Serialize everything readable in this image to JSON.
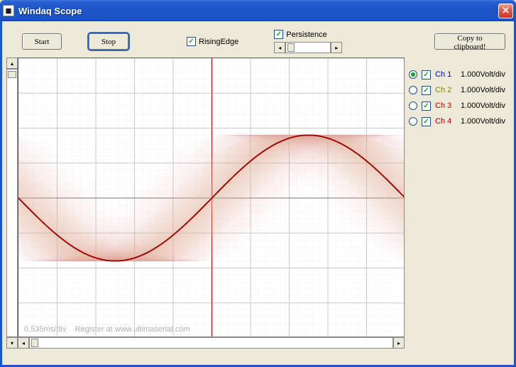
{
  "window": {
    "title": "Windaq Scope",
    "icon_label": "▦"
  },
  "toolbar": {
    "start_label": "Start",
    "stop_label": "Stop",
    "rising_edge_label": "RisingEdge",
    "rising_edge_checked": true,
    "persistence_label": "Persistence",
    "persistence_checked": true,
    "copy_label": "Copy to clipboard!"
  },
  "scope": {
    "timebase_watermark": "0.535ms/div",
    "register_watermark": "Register at www.ultimaserial.com"
  },
  "channels": [
    {
      "selected": true,
      "enabled": true,
      "name": "Ch 1",
      "color_class": "ch-blue",
      "scale": "1.000Volt/div"
    },
    {
      "selected": false,
      "enabled": true,
      "name": "Ch 2",
      "color_class": "ch-olive",
      "scale": "1.000Volt/div"
    },
    {
      "selected": false,
      "enabled": true,
      "name": "Ch 3",
      "color_class": "ch-red",
      "scale": "1.000Volt/div"
    },
    {
      "selected": false,
      "enabled": true,
      "name": "Ch 4",
      "color_class": "ch-dred",
      "scale": "1.000Volt/div"
    }
  ],
  "chart_data": {
    "type": "line",
    "title": "",
    "description": "Four overlaid sine waves with persistence (afterglow of many previous sweeps). Channels 2–4 drift in phase relative to Ch1, producing the smeared fan of traces on either side of the trigger point.",
    "x_divisions": 10,
    "y_divisions": 8,
    "timebase": "0.535ms/div",
    "vertical": "1.000Volt/div",
    "trigger_position_div": 5,
    "amplitude_div": 3.6,
    "phase_offset_div": -2.5,
    "series": [
      {
        "name": "Ch 1",
        "color": "#0000d0"
      },
      {
        "name": "Ch 2",
        "color": "#808000"
      },
      {
        "name": "Ch 3",
        "color": "#c00000"
      },
      {
        "name": "Ch 4",
        "color": "#a00000"
      }
    ]
  }
}
